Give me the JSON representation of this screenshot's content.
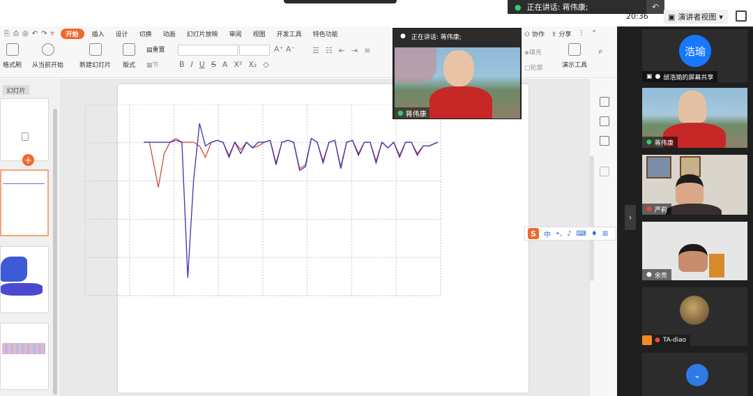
{
  "meeting": {
    "speaking_label": "正在讲话: 蒋伟康;",
    "clock": "20:36",
    "presenter_view_label": "演讲者视图"
  },
  "ribbon": {
    "tabs": [
      "开始",
      "插入",
      "设计",
      "切换",
      "动画",
      "幻灯片放映",
      "审阅",
      "视图",
      "开发工具",
      "特色功能"
    ],
    "active_tab": "开始",
    "collab_label": "协作",
    "share_label": "分享",
    "buttons": {
      "format_painter": "格式刷",
      "from_current": "从当前开始",
      "new_slide": "新建幻灯片",
      "layout": "版式",
      "reset": "重置",
      "section": "节",
      "fill": "填充",
      "outline": "轮廓",
      "present_tools": "演示工具"
    }
  },
  "slide_panel": {
    "label": "幻灯片"
  },
  "float_window": {
    "speaking_label": "正在讲话: 蒋伟康;",
    "name": "蒋伟康"
  },
  "ime": {
    "lang": "中"
  },
  "participants": [
    {
      "name": "邰浩瑜的屏幕共享",
      "avatar_text": "浩瑜"
    },
    {
      "name": "蒋伟康"
    },
    {
      "name": "严莉"
    },
    {
      "name": "余亮"
    },
    {
      "name": "TA-diao"
    }
  ],
  "colors": {
    "accent": "#f4662b",
    "series_red": "#cc4b3c",
    "series_blue": "#3b2fb0",
    "avatar_blue": "#1677ff"
  },
  "chart_data": {
    "type": "line",
    "x": [
      0,
      0.02,
      0.05,
      0.07,
      0.09,
      0.11,
      0.13,
      0.15,
      0.17,
      0.19,
      0.21,
      0.23,
      0.25,
      0.27,
      0.29,
      0.31,
      0.33,
      0.35,
      0.37,
      0.39,
      0.41,
      0.43,
      0.45,
      0.47,
      0.49,
      0.51,
      0.53,
      0.55,
      0.57,
      0.59,
      0.61,
      0.63,
      0.65,
      0.67,
      0.69,
      0.71,
      0.73,
      0.75,
      0.77,
      0.79,
      0.81,
      0.83,
      0.85,
      0.87,
      0.89,
      0.91,
      0.93,
      0.95,
      0.97,
      1.0
    ],
    "series": [
      {
        "values": [
          0,
          0,
          -1.2,
          -0.3,
          0,
          0.1,
          0,
          0,
          0,
          -0.1,
          -0.4,
          0,
          0.05,
          0,
          -0.35,
          0,
          -0.2,
          0,
          -0.15,
          -0.1,
          0,
          0.05,
          -0.55,
          0,
          0.05,
          0,
          -0.7,
          -0.6,
          0.1,
          0,
          -0.5,
          0,
          0.05,
          -0.65,
          0,
          0.05,
          -0.3,
          0,
          0,
          -0.5,
          0,
          -0.15,
          0,
          -0.35,
          0,
          0,
          -0.3,
          -0.1,
          -0.1,
          0
        ]
      },
      {
        "values": [
          0,
          0,
          0,
          0,
          0,
          0.05,
          0,
          -3.6,
          -1.0,
          0.5,
          -0.1,
          0,
          0.05,
          0,
          -0.4,
          0,
          -0.3,
          0,
          -0.15,
          0,
          0,
          0.05,
          -0.6,
          0,
          0.05,
          0,
          -0.75,
          -0.65,
          0.1,
          0,
          -0.55,
          0,
          0.05,
          -0.7,
          0,
          0.05,
          -0.35,
          0,
          0,
          -0.55,
          0,
          -0.15,
          0,
          -0.4,
          0,
          0,
          -0.35,
          -0.1,
          -0.1,
          0
        ]
      }
    ],
    "ylim": [
      -4,
      1
    ],
    "grid": true
  }
}
